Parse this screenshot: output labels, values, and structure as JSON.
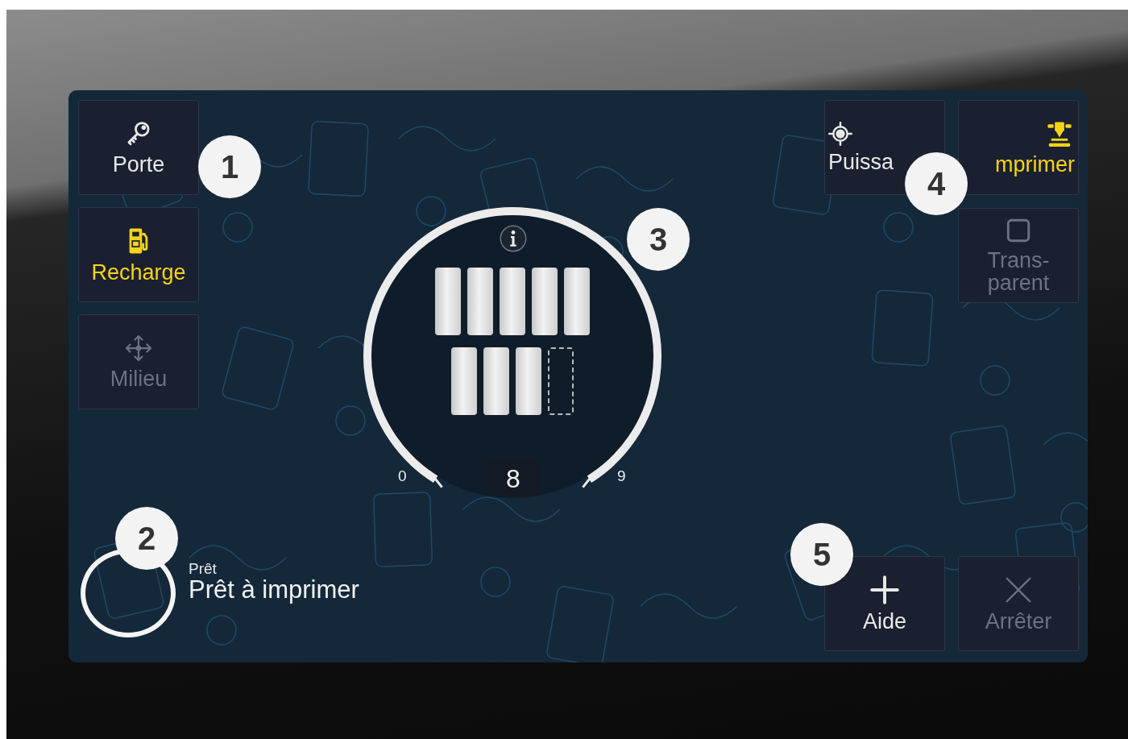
{
  "left_buttons": [
    {
      "label": "Porte",
      "kind": "key",
      "highlighted": false,
      "disabled": false
    },
    {
      "label": "Recharge",
      "kind": "pump",
      "highlighted": true,
      "disabled": false
    },
    {
      "label": "Milieu",
      "kind": "move",
      "highlighted": false,
      "disabled": true
    }
  ],
  "right_buttons": [
    {
      "label": "Puissa",
      "kind": "target",
      "highlighted": false,
      "disabled": false
    },
    {
      "label": "mprimer",
      "kind": "printer",
      "highlighted": true,
      "disabled": false
    },
    {
      "label": "Trans-parent",
      "kind": "square",
      "highlighted": false,
      "disabled": true
    }
  ],
  "gauge": {
    "min": "0",
    "max": "9",
    "value": "8",
    "slots": [
      {
        "filled": true
      },
      {
        "filled": true
      },
      {
        "filled": true
      },
      {
        "filled": true
      },
      {
        "filled": true
      },
      {
        "filled": true
      },
      {
        "filled": true
      },
      {
        "filled": true
      },
      {
        "filled": false
      }
    ]
  },
  "status": {
    "title": "Prêt",
    "message": "Prêt à imprimer"
  },
  "bottom_buttons": [
    {
      "label": "Aide",
      "kind": "plus",
      "highlighted": false,
      "disabled": false
    },
    {
      "label": "Arrêter",
      "kind": "close",
      "highlighted": false,
      "disabled": true
    }
  ],
  "callouts": [
    "1",
    "2",
    "3",
    "4",
    "5"
  ]
}
